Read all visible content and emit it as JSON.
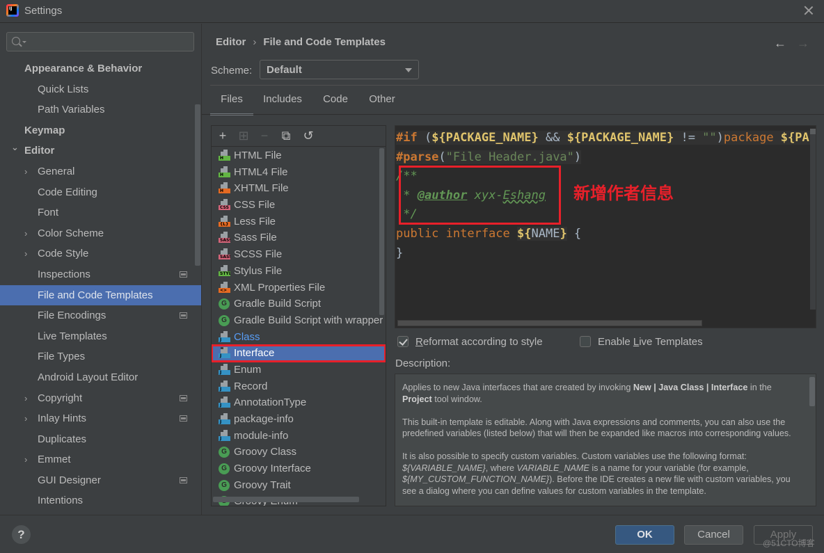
{
  "window": {
    "title": "Settings",
    "logo_text": "IJ"
  },
  "sidebar": {
    "search": {
      "value": "",
      "placeholder": ""
    },
    "items": [
      {
        "label": "Appearance & Behavior",
        "level": 0,
        "bold": true,
        "arrow": "",
        "project_icon": false,
        "selected": false
      },
      {
        "label": "Quick Lists",
        "level": 1,
        "bold": false,
        "arrow": "",
        "project_icon": false,
        "selected": false
      },
      {
        "label": "Path Variables",
        "level": 1,
        "bold": false,
        "arrow": "",
        "project_icon": false,
        "selected": false
      },
      {
        "label": "Keymap",
        "level": 0,
        "bold": true,
        "arrow": "",
        "project_icon": false,
        "selected": false
      },
      {
        "label": "Editor",
        "level": 0,
        "bold": true,
        "arrow": "expanded",
        "project_icon": false,
        "selected": false
      },
      {
        "label": "General",
        "level": 1,
        "bold": false,
        "arrow": "collapsed",
        "project_icon": false,
        "selected": false
      },
      {
        "label": "Code Editing",
        "level": 1,
        "bold": false,
        "arrow": "",
        "project_icon": false,
        "selected": false
      },
      {
        "label": "Font",
        "level": 1,
        "bold": false,
        "arrow": "",
        "project_icon": false,
        "selected": false
      },
      {
        "label": "Color Scheme",
        "level": 1,
        "bold": false,
        "arrow": "collapsed",
        "project_icon": false,
        "selected": false
      },
      {
        "label": "Code Style",
        "level": 1,
        "bold": false,
        "arrow": "collapsed",
        "project_icon": false,
        "selected": false
      },
      {
        "label": "Inspections",
        "level": 1,
        "bold": false,
        "arrow": "",
        "project_icon": true,
        "selected": false
      },
      {
        "label": "File and Code Templates",
        "level": 1,
        "bold": false,
        "arrow": "",
        "project_icon": false,
        "selected": true
      },
      {
        "label": "File Encodings",
        "level": 1,
        "bold": false,
        "arrow": "",
        "project_icon": true,
        "selected": false
      },
      {
        "label": "Live Templates",
        "level": 1,
        "bold": false,
        "arrow": "",
        "project_icon": false,
        "selected": false
      },
      {
        "label": "File Types",
        "level": 1,
        "bold": false,
        "arrow": "",
        "project_icon": false,
        "selected": false
      },
      {
        "label": "Android Layout Editor",
        "level": 1,
        "bold": false,
        "arrow": "",
        "project_icon": false,
        "selected": false
      },
      {
        "label": "Copyright",
        "level": 1,
        "bold": false,
        "arrow": "collapsed",
        "project_icon": true,
        "selected": false
      },
      {
        "label": "Inlay Hints",
        "level": 1,
        "bold": false,
        "arrow": "collapsed",
        "project_icon": true,
        "selected": false
      },
      {
        "label": "Duplicates",
        "level": 1,
        "bold": false,
        "arrow": "",
        "project_icon": false,
        "selected": false
      },
      {
        "label": "Emmet",
        "level": 1,
        "bold": false,
        "arrow": "collapsed",
        "project_icon": false,
        "selected": false
      },
      {
        "label": "GUI Designer",
        "level": 1,
        "bold": false,
        "arrow": "",
        "project_icon": true,
        "selected": false
      },
      {
        "label": "Intentions",
        "level": 1,
        "bold": false,
        "arrow": "",
        "project_icon": false,
        "selected": false
      }
    ]
  },
  "header": {
    "breadcrumb": [
      "Editor",
      "File and Code Templates"
    ],
    "breadcrumb_separator": "›",
    "back_icon": "←",
    "forward_icon": "→"
  },
  "scheme": {
    "label": "Scheme:",
    "value": "Default"
  },
  "tabs": [
    {
      "label": "Files",
      "active": true
    },
    {
      "label": "Includes",
      "active": false
    },
    {
      "label": "Code",
      "active": false
    },
    {
      "label": "Other",
      "active": false
    }
  ],
  "toolbar": {
    "add_icon": "+",
    "add_child_icon": "⊞",
    "remove_icon": "−",
    "copy_icon": "⧉",
    "reset_icon": "↺"
  },
  "templates": [
    {
      "label": "HTML File",
      "icon": "file",
      "badge": "H",
      "badge_color": "#62b543",
      "style": ""
    },
    {
      "label": "HTML4 File",
      "icon": "file",
      "badge": "H",
      "badge_color": "#62b543",
      "style": ""
    },
    {
      "label": "XHTML File",
      "icon": "file",
      "badge": "H",
      "badge_color": "#e56a22",
      "style": ""
    },
    {
      "label": "CSS File",
      "icon": "file",
      "badge": "CSS",
      "badge_color": "#d6657a",
      "style": ""
    },
    {
      "label": "Less File",
      "icon": "file",
      "badge": "{L}",
      "badge_color": "#e56a22",
      "style": ""
    },
    {
      "label": "Sass File",
      "icon": "file",
      "badge": "SASS",
      "badge_color": "#d6657a",
      "style": ""
    },
    {
      "label": "SCSS File",
      "icon": "file",
      "badge": "SASS",
      "badge_color": "#d6657a",
      "style": ""
    },
    {
      "label": "Stylus File",
      "icon": "file",
      "badge": "STYL",
      "badge_color": "#62b543",
      "style": ""
    },
    {
      "label": "XML Properties File",
      "icon": "file",
      "badge": "<>",
      "badge_color": "#e56a22",
      "style": ""
    },
    {
      "label": "Gradle Build Script",
      "icon": "groovy",
      "badge": "G",
      "badge_color": "#499c54",
      "style": ""
    },
    {
      "label": "Gradle Build Script with wrapper",
      "icon": "groovy",
      "badge": "G",
      "badge_color": "#499c54",
      "style": ""
    },
    {
      "label": "Class",
      "icon": "file",
      "badge": "J",
      "badge_color": "#3592c4",
      "style": "link"
    },
    {
      "label": "Interface",
      "icon": "file",
      "badge": "J",
      "badge_color": "#3592c4",
      "style": "selected"
    },
    {
      "label": "Enum",
      "icon": "file",
      "badge": "J",
      "badge_color": "#3592c4",
      "style": ""
    },
    {
      "label": "Record",
      "icon": "file",
      "badge": "J",
      "badge_color": "#3592c4",
      "style": ""
    },
    {
      "label": "AnnotationType",
      "icon": "file",
      "badge": "J",
      "badge_color": "#3592c4",
      "style": ""
    },
    {
      "label": "package-info",
      "icon": "file",
      "badge": "J",
      "badge_color": "#3592c4",
      "style": ""
    },
    {
      "label": "module-info",
      "icon": "file",
      "badge": "J",
      "badge_color": "#3592c4",
      "style": ""
    },
    {
      "label": "Groovy Class",
      "icon": "groovy",
      "badge": "G",
      "badge_color": "#499c54",
      "style": ""
    },
    {
      "label": "Groovy Interface",
      "icon": "groovy",
      "badge": "G",
      "badge_color": "#499c54",
      "style": ""
    },
    {
      "label": "Groovy Trait",
      "icon": "groovy",
      "badge": "G",
      "badge_color": "#499c54",
      "style": ""
    },
    {
      "label": "Groovy Enum",
      "icon": "groovy",
      "badge": "G",
      "badge_color": "#499c54",
      "style": ""
    }
  ],
  "editor": {
    "lines": {
      "l1_if": "#if",
      "l1_rest_a": " (",
      "l1_var1": "${PACKAGE_NAME}",
      "l1_and": " && ",
      "l1_var2": "${PACKAGE_NAME}",
      "l1_neq": " != ",
      "l1_str": "\"\"",
      "l1_close": ")",
      "l1_pkg": "package ",
      "l1_var3": "${PAC",
      "l2_parse": "#parse",
      "l2_open": "(",
      "l2_str": "\"File Header.java\"",
      "l2_close": ")",
      "l3": "/**",
      "l4_star": " * ",
      "l4_tag": "@author",
      "l4_sp": " xyx-",
      "l4_name": "Eshang",
      "l5": " */",
      "l6_kw": "public interface ",
      "l6_var_open": "${",
      "l6_var_name": "NAME",
      "l6_var_close": "}",
      "l6_brace": " {",
      "l7": "}"
    },
    "annotation": "新增作者信息",
    "annotation_color": "#e8202a"
  },
  "options": {
    "reformat": {
      "label_prefix": "",
      "mnemonic": "R",
      "label_rest": "eformat according to style",
      "checked": true
    },
    "live_templates": {
      "label_prefix": "Enable ",
      "mnemonic": "L",
      "label_rest": "ive Templates",
      "checked": false
    }
  },
  "description": {
    "label": "Description:",
    "p1_a": "Applies to new Java interfaces that are created by invoking ",
    "p1_b": "New | Java Class | Interface",
    "p1_c": " in the ",
    "p1_d": "Project",
    "p1_e": " tool window.",
    "p2": "This built-in template is editable. Along with Java expressions and comments, you can also use the predefined variables (listed below) that will then be expanded like macros into corresponding values.",
    "p3_a": "It is also possible to specify custom variables. Custom variables use the following format: ",
    "p3_b": "${VARIABLE_NAME}",
    "p3_c": ", where ",
    "p3_d": "VARIABLE_NAME",
    "p3_e": " is a name for your variable (for example, ",
    "p3_f": "${MY_CUSTOM_FUNCTION_NAME}",
    "p3_g": "). Before the IDE creates a new file with custom variables, you see a dialog where you can define values for custom variables in the template."
  },
  "footer": {
    "help_label": "?",
    "ok_label": "OK",
    "cancel_label": "Cancel",
    "apply_label": "Apply",
    "watermark": "@51CTO博客"
  }
}
